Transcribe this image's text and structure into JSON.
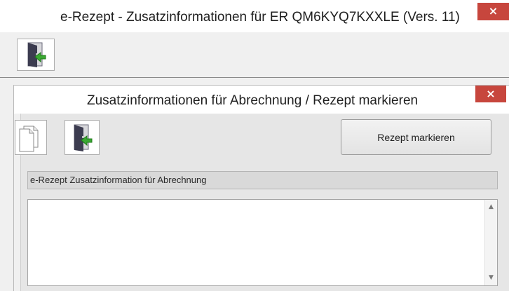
{
  "window": {
    "title": "e-Rezept - Zusatzinformationen für ER QM6KYQ7KXXLE (Vers. 11)",
    "close_label": "×"
  },
  "toolbar": {
    "exit_icon": "exit-door-icon"
  },
  "dialog": {
    "title": "Zusatzinformationen für Abrechnung / Rezept markieren",
    "close_label": "×",
    "new_icon": "new-document-icon",
    "exit_icon": "exit-door-icon",
    "mark_button_label": "Rezept markieren",
    "section_header": "e-Rezept Zusatzinformation für Abrechnung",
    "textarea_value": "",
    "scroll_up": "▲",
    "scroll_down": "▼"
  },
  "colors": {
    "close_red": "#c7463d",
    "door_dark": "#3c3c50",
    "arrow_green": "#3aa832"
  }
}
